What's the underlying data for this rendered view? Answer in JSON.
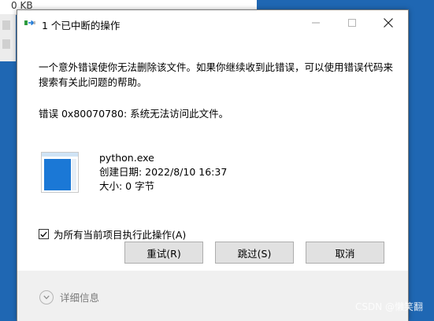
{
  "background": {
    "explorer_size": "0 KB"
  },
  "dialog": {
    "title": "1 个已中断的操作",
    "message": "一个意外错误使你无法删除该文件。如果你继续收到此错误，可以使用错误代码来搜索有关此问题的帮助。",
    "error_line": "错误 0x80070780: 系统无法访问此文件。",
    "file": {
      "name": "python.exe",
      "created": "创建日期: 2022/8/10 16:37",
      "size": "大小: 0 字节"
    },
    "checkbox": {
      "label": "为所有当前项目执行此操作(A)",
      "checked": true
    },
    "buttons": {
      "retry": "重试(R)",
      "skip": "跳过(S)",
      "cancel": "取消"
    },
    "details_label": "详细信息"
  },
  "watermark": "CSDN @懒笑翻",
  "colors": {
    "desktop": "#1f67b3",
    "dialog_bg": "#f0f0f0",
    "button_bg": "#e1e1e1",
    "file_pane": "#1b78d6"
  },
  "icons": {
    "title": "file-transfer-icon",
    "checkbox": "checkmark-icon",
    "details": "chevron-down-icon"
  }
}
